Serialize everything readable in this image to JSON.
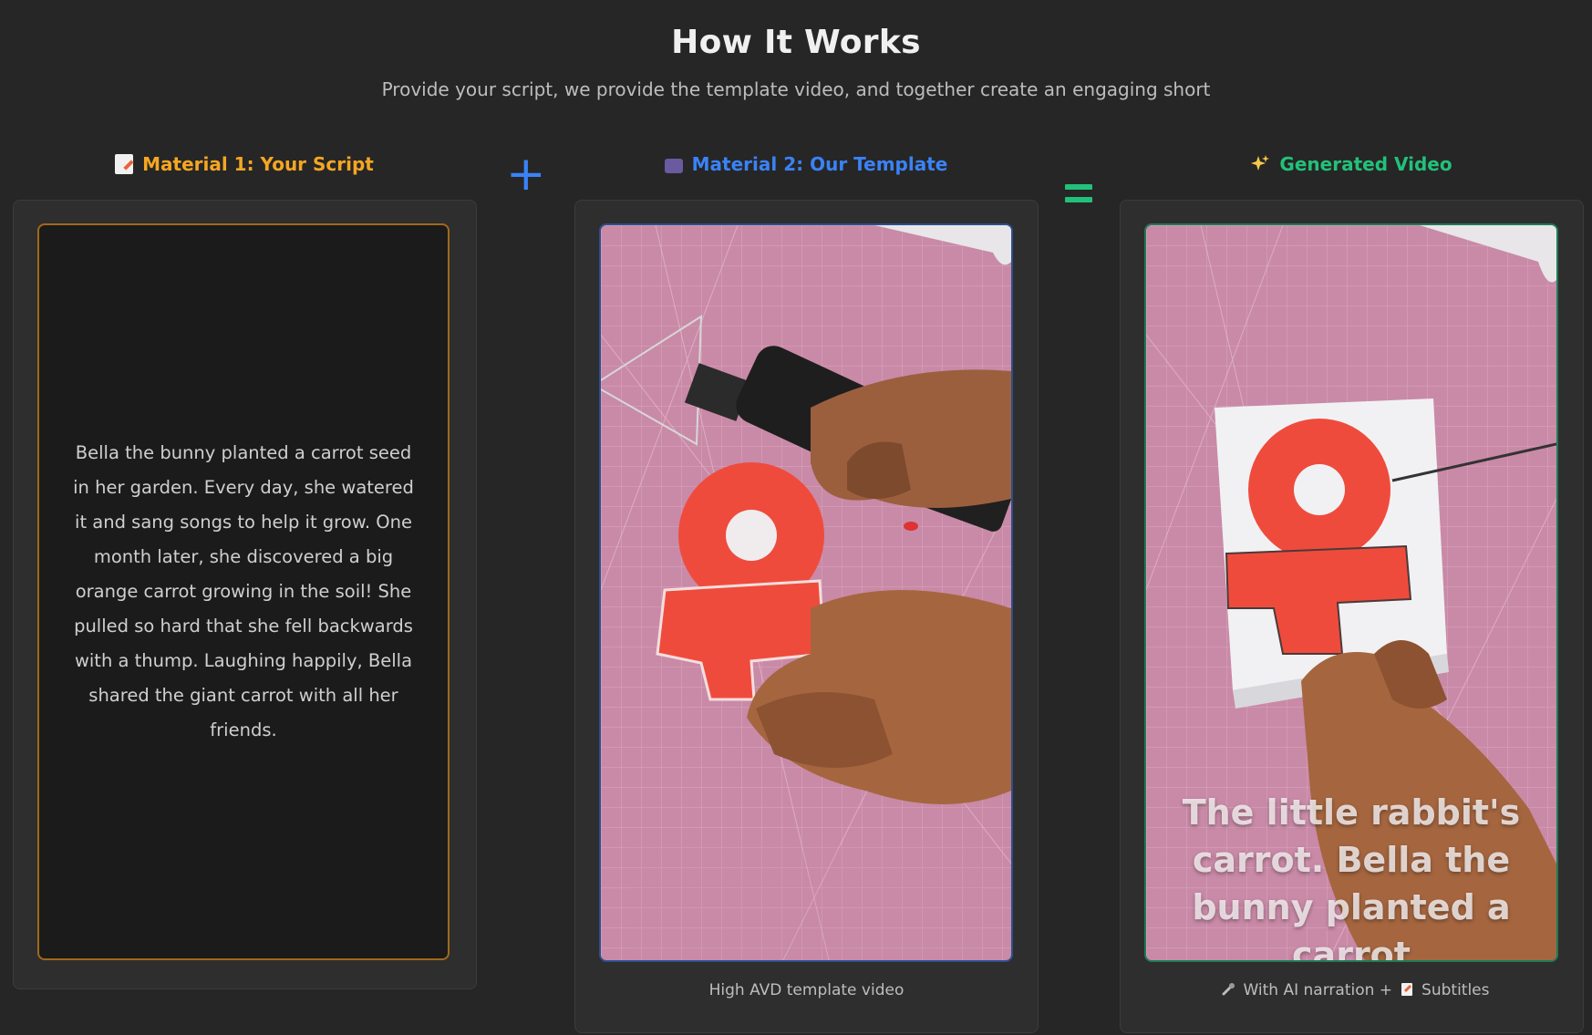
{
  "header": {
    "title": "How It Works",
    "subtitle": "Provide your script, we provide the template video, and together create an engaging short"
  },
  "columns": {
    "script": {
      "label": "Material 1: Your Script",
      "icon": "memo-icon",
      "color": "#f5a623",
      "text": "Bella the bunny planted a carrot seed in her garden. Every day, she watered it and sang songs to help it grow. One month later, she discovered a big orange carrot growing in the soil! She pulled so hard that she fell backwards with a thump. Laughing happily, Bella shared the giant carrot with all her friends."
    },
    "template": {
      "label": "Material 2: Our Template",
      "icon": "film-icon",
      "color": "#3b82f6",
      "caption": "High AVD template video"
    },
    "generated": {
      "label": "Generated Video",
      "icon": "sparkles-icon",
      "color": "#22c17a",
      "overlay_text": "The little rabbit's carrot. Bella the bunny planted a carrot",
      "caption_part1": "With AI narration +",
      "caption_part2": "Subtitles"
    }
  },
  "operators": {
    "plus": "+",
    "equals": "="
  }
}
